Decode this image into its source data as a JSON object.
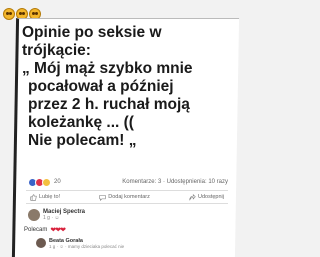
{
  "emojis": [
    "dizzy-face",
    "dizzy-face",
    "dizzy-face"
  ],
  "post": {
    "lines": [
      "Opinie po seksie w",
      "trójkącie:",
      "„ Mój mąż szybko mnie",
      "pocałował a później",
      "przez 2 h. ruchał moją",
      "koleżankę ... ((",
      "Nie polecam! „"
    ]
  },
  "meta": {
    "reaction_count": "20",
    "stats": "Komentarze: 3 · Udostępnienia: 10 razy"
  },
  "actions": {
    "like": "Lubię to!",
    "comment": "Dodaj komentarz",
    "share": "Udostępnij"
  },
  "comments": [
    {
      "name": "Maciej Spectra",
      "sub": "1 g · ☺",
      "text": "Polecam",
      "hearts": "❤❤❤"
    },
    {
      "name": "Beata Gorała",
      "sub": "1 g · ☺ · mamy dzieciaka polecać nie"
    }
  ]
}
